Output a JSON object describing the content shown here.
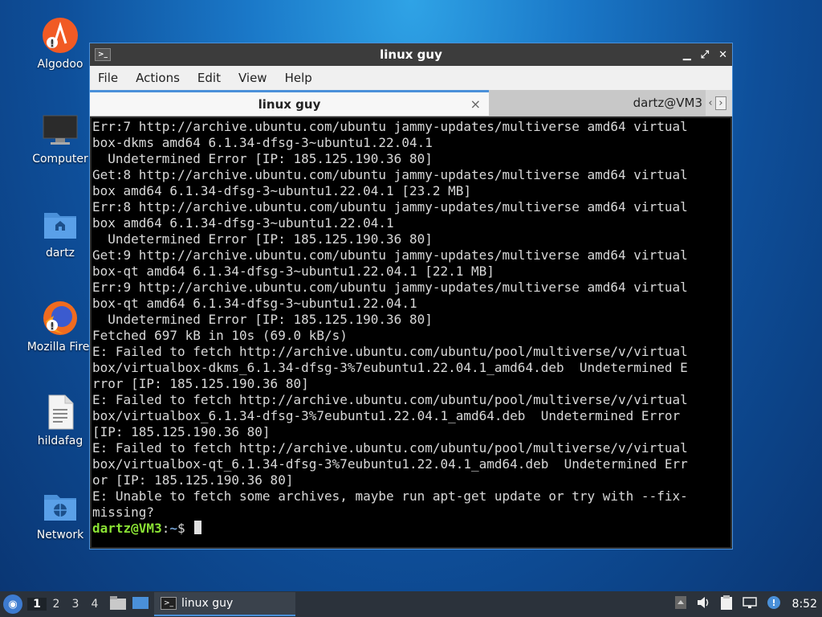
{
  "desktop": {
    "icons": [
      {
        "label": "Algodoo",
        "icon": "algodoo-icon"
      },
      {
        "label": "Computer",
        "icon": "computer-icon"
      },
      {
        "label": "dartz",
        "icon": "home-folder-icon"
      },
      {
        "label": "Mozilla Firef",
        "icon": "firefox-icon"
      },
      {
        "label": "hildafag",
        "icon": "document-icon"
      },
      {
        "label": "Network",
        "icon": "network-folder-icon"
      }
    ]
  },
  "window": {
    "title": "linux guy",
    "menu": [
      "File",
      "Actions",
      "Edit",
      "View",
      "Help"
    ],
    "tabs": [
      {
        "label": "linux guy",
        "close": "×"
      },
      {
        "label": "dartz@VM3"
      }
    ],
    "terminal": {
      "lines": [
        "Err:7 http://archive.ubuntu.com/ubuntu jammy-updates/multiverse amd64 virtual",
        "box-dkms amd64 6.1.34-dfsg-3~ubuntu1.22.04.1",
        "  Undetermined Error [IP: 185.125.190.36 80]",
        "Get:8 http://archive.ubuntu.com/ubuntu jammy-updates/multiverse amd64 virtual",
        "box amd64 6.1.34-dfsg-3~ubuntu1.22.04.1 [23.2 MB]",
        "Err:8 http://archive.ubuntu.com/ubuntu jammy-updates/multiverse amd64 virtual",
        "box amd64 6.1.34-dfsg-3~ubuntu1.22.04.1",
        "  Undetermined Error [IP: 185.125.190.36 80]",
        "Get:9 http://archive.ubuntu.com/ubuntu jammy-updates/multiverse amd64 virtual",
        "box-qt amd64 6.1.34-dfsg-3~ubuntu1.22.04.1 [22.1 MB]",
        "Err:9 http://archive.ubuntu.com/ubuntu jammy-updates/multiverse amd64 virtual",
        "box-qt amd64 6.1.34-dfsg-3~ubuntu1.22.04.1",
        "  Undetermined Error [IP: 185.125.190.36 80]",
        "Fetched 697 kB in 10s (69.0 kB/s)",
        "E: Failed to fetch http://archive.ubuntu.com/ubuntu/pool/multiverse/v/virtual",
        "box/virtualbox-dkms_6.1.34-dfsg-3%7eubuntu1.22.04.1_amd64.deb  Undetermined E",
        "rror [IP: 185.125.190.36 80]",
        "E: Failed to fetch http://archive.ubuntu.com/ubuntu/pool/multiverse/v/virtual",
        "box/virtualbox_6.1.34-dfsg-3%7eubuntu1.22.04.1_amd64.deb  Undetermined Error",
        "[IP: 185.125.190.36 80]",
        "E: Failed to fetch http://archive.ubuntu.com/ubuntu/pool/multiverse/v/virtual",
        "box/virtualbox-qt_6.1.34-dfsg-3%7eubuntu1.22.04.1_amd64.deb  Undetermined Err",
        "or [IP: 185.125.190.36 80]",
        "E: Unable to fetch some archives, maybe run apt-get update or try with --fix-",
        "missing?"
      ],
      "prompt_user": "dartz@VM3",
      "prompt_sep": ":",
      "prompt_path": "~",
      "prompt_symbol": "$"
    }
  },
  "taskbar": {
    "workspaces": [
      "1",
      "2",
      "3",
      "4"
    ],
    "task_label": "linux guy",
    "clock": "8:52"
  }
}
